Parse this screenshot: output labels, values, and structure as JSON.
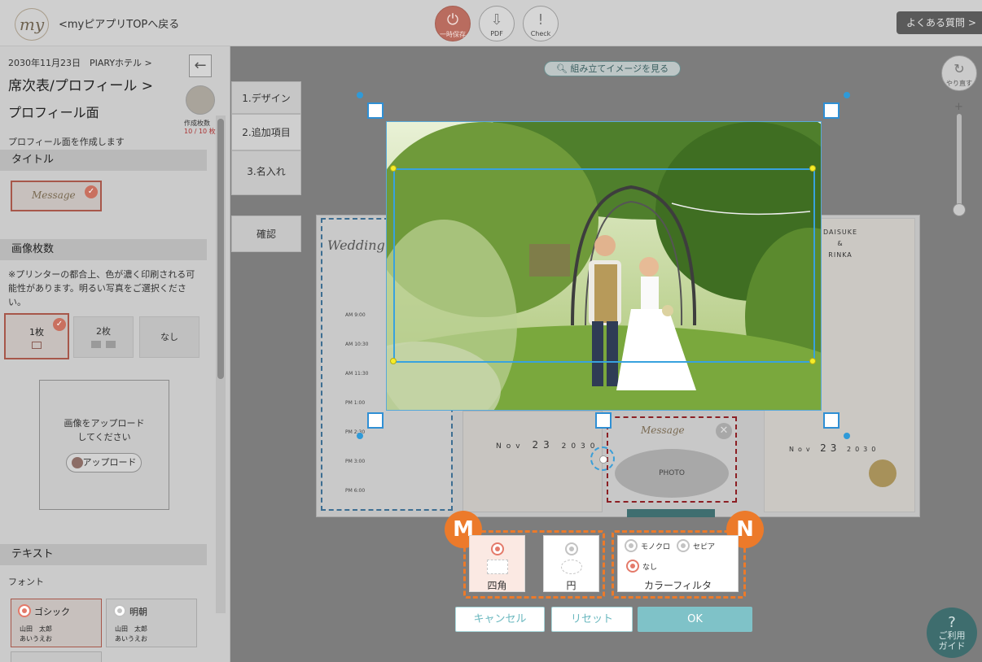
{
  "header": {
    "logo_text": "my",
    "back_link": "<myピアプリTOPへ戻る",
    "buttons": [
      {
        "label": "一時保存",
        "icon": "power-icon"
      },
      {
        "label": "PDF",
        "icon": "download-icon"
      },
      {
        "label": "Check",
        "icon": "exclamation-icon"
      }
    ],
    "faq": "よくある質問 >"
  },
  "sidebar": {
    "breadcrumb": "2030年11月23日　PIARYホテル >",
    "title": "席次表/プロフィール >",
    "subtitle": "プロフィール面",
    "description": "プロフィール面を作成します",
    "count_label": "作成枚数",
    "count_value": "10 / 10 枚",
    "sections": {
      "title": "タイトル",
      "image_count": "画像枚数",
      "text": "テキスト"
    },
    "title_thumb_text": "Message",
    "printer_note": "※プリンターの都合上、色が濃く印刷される可能性があります。明るい写真をご選択ください。",
    "image_options": [
      "1枚",
      "2枚",
      "なし"
    ],
    "upload_text": "画像をアップロードしてください",
    "upload_button": "アップロード",
    "font_label": "フォント",
    "fonts": [
      {
        "name": "ゴシック",
        "sample_name": "山田　太郎",
        "sample_kana": "あいうえお"
      },
      {
        "name": "明朝",
        "sample_name": "山田　太郎",
        "sample_kana": "あいうえお"
      }
    ]
  },
  "steps": [
    "1.デザイン",
    "2.追加項目",
    "3.名入れ",
    "確認"
  ],
  "canvas": {
    "preview_button": "組み立てイメージを見る",
    "redo_label": "やり直す",
    "zoom_plus": "+",
    "help": "ご利用ガイド",
    "help_mark": "?",
    "card_left_title": "Wedding",
    "timeline": [
      "AM 9:00",
      "AM 10:30",
      "AM 11:30",
      "PM 1:00",
      "PM 2:30",
      "PM 3:00",
      "PM 6:00"
    ],
    "card_mid_date": [
      "Nov",
      "23",
      "2030"
    ],
    "card_photo_title": "Message",
    "photo_placeholder": "PHOTO",
    "card_right_names": [
      "DAISUKE",
      "&",
      "RINKA"
    ],
    "card_right_date": [
      "Nov",
      "23",
      "2030"
    ]
  },
  "editor": {
    "marker_m": "M",
    "marker_n": "N",
    "shapes": [
      {
        "label": "四角",
        "selected": true
      },
      {
        "label": "円",
        "selected": false
      }
    ],
    "filter_options": [
      {
        "label": "モノクロ",
        "selected": false
      },
      {
        "label": "セピア",
        "selected": false
      },
      {
        "label": "なし",
        "selected": true
      }
    ],
    "filter_label": "カラーフィルタ",
    "cancel": "キャンセル",
    "reset": "リセット",
    "ok": "OK"
  },
  "colors": {
    "accent_orange": "#ec7a2a",
    "crop_blue": "#38a2de",
    "ok_teal": "#7fc2c8",
    "selected_coral": "#e47a6a"
  }
}
